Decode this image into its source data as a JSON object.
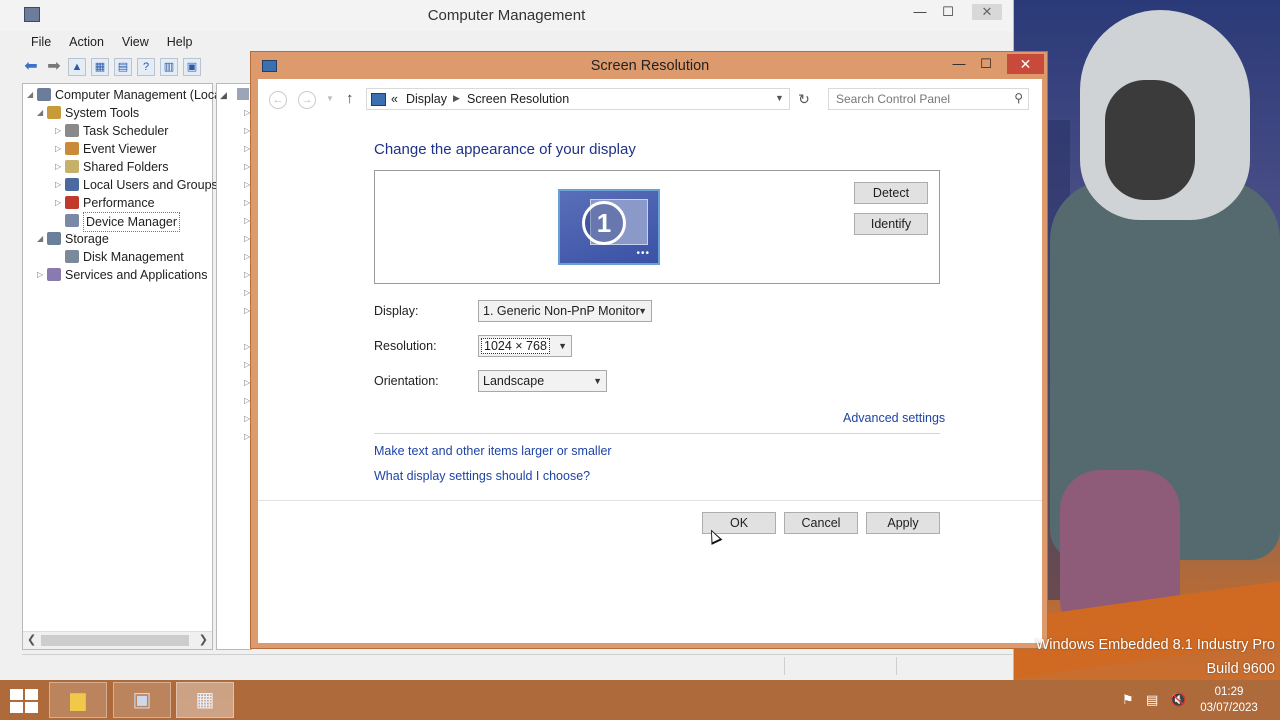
{
  "computer_management": {
    "title": "Computer Management",
    "menu": [
      "File",
      "Action",
      "View",
      "Help"
    ],
    "tree": [
      {
        "label": "Computer Management (Local",
        "icon": "computer-management-icon",
        "arrow": "◢"
      },
      {
        "label": "System Tools",
        "icon": "tools-icon",
        "arrow": "◢"
      },
      {
        "label": "Task Scheduler",
        "icon": "clock-icon",
        "arrow": "▷"
      },
      {
        "label": "Event Viewer",
        "icon": "event-viewer-icon",
        "arrow": "▷"
      },
      {
        "label": "Shared Folders",
        "icon": "shared-folder-icon",
        "arrow": "▷"
      },
      {
        "label": "Local Users and Groups",
        "icon": "users-icon",
        "arrow": "▷"
      },
      {
        "label": "Performance",
        "icon": "performance-icon",
        "arrow": "▷"
      },
      {
        "label": "Device Manager",
        "icon": "device-manager-icon",
        "arrow": ""
      },
      {
        "label": "Storage",
        "icon": "storage-icon",
        "arrow": "◢"
      },
      {
        "label": "Disk Management",
        "icon": "disk-icon",
        "arrow": ""
      },
      {
        "label": "Services and Applications",
        "icon": "services-icon",
        "arrow": "▷"
      }
    ]
  },
  "screen_resolution": {
    "title": "Screen Resolution",
    "breadcrumb": [
      "«",
      "Display",
      "Screen Resolution"
    ],
    "search_placeholder": "Search Control Panel",
    "heading": "Change the appearance of your display",
    "monitor_number": "1",
    "detect_label": "Detect",
    "identify_label": "Identify",
    "display_label": "Display:",
    "display_value": "1. Generic Non-PnP Monitor",
    "resolution_label": "Resolution:",
    "resolution_value": "1024 × 768",
    "orientation_label": "Orientation:",
    "orientation_value": "Landscape",
    "advanced_link": "Advanced settings",
    "link_text_size": "Make text and other items larger or smaller",
    "link_help": "What display settings should I choose?",
    "ok_label": "OK",
    "cancel_label": "Cancel",
    "apply_label": "Apply"
  },
  "watermark": {
    "line1": "Windows Embedded 8.1 Industry Pro",
    "line2": "Build 9600"
  },
  "taskbar": {
    "time": "01:29",
    "date": "03/07/2023"
  },
  "colors": {
    "dialog_frame": "#dd9a6c",
    "link_blue": "#1e44a6",
    "heading_blue": "#1e3287",
    "close_red": "#c74a3a"
  }
}
